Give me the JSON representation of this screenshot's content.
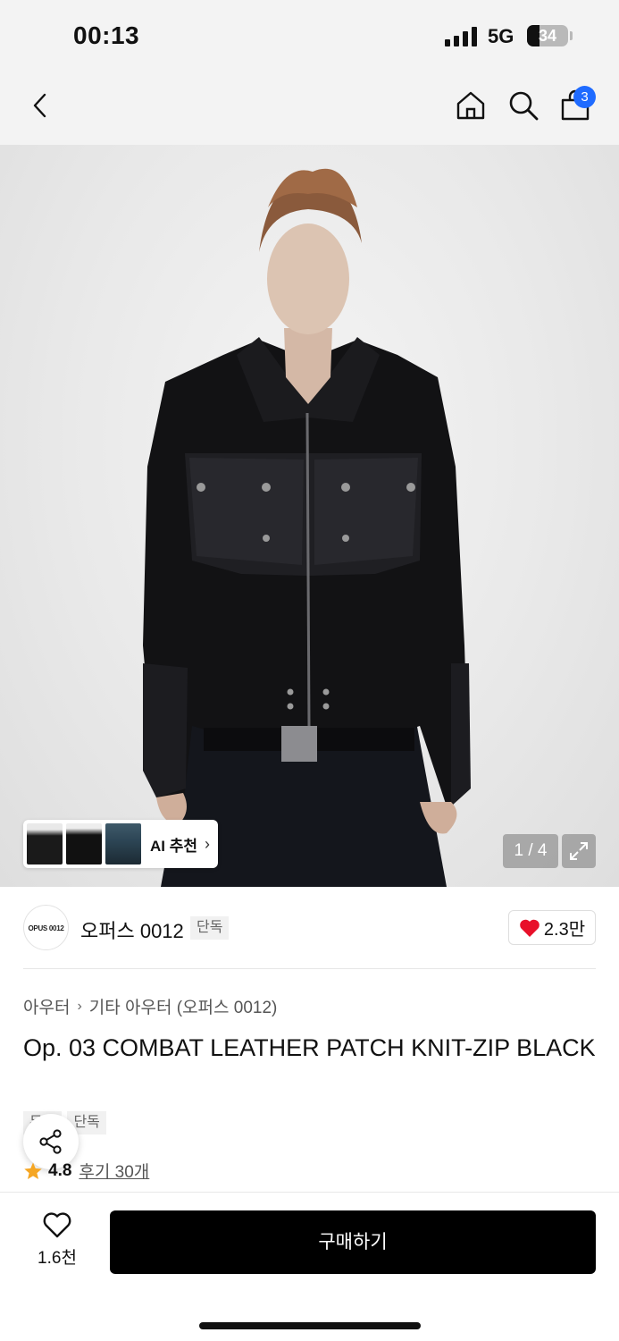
{
  "status_bar": {
    "time": "00:13",
    "network": "5G",
    "battery": "34"
  },
  "nav": {
    "cart_count": "3"
  },
  "gallery": {
    "ai_label": "AI 추천",
    "counter": "1 / 4"
  },
  "brand": {
    "logo_text": "OPUS 0012",
    "name": "오퍼스 0012",
    "tag": "단독",
    "likes": "2.3만"
  },
  "product": {
    "breadcrumb": [
      "아우터",
      "기타 아우터 (오퍼스 0012)"
    ],
    "title": "Op. 03 COMBAT LEATHER PATCH KNIT-ZIP BLACK",
    "tags": [
      "무배",
      "단독"
    ],
    "rating": "4.8",
    "reviews": "후기 30개"
  },
  "bottom": {
    "wish_count": "1.6천",
    "buy_label": "구매하기"
  },
  "colors": {
    "accent_blue": "#1f6bff",
    "heart_red": "#e8102a",
    "star": "#f5a623"
  }
}
